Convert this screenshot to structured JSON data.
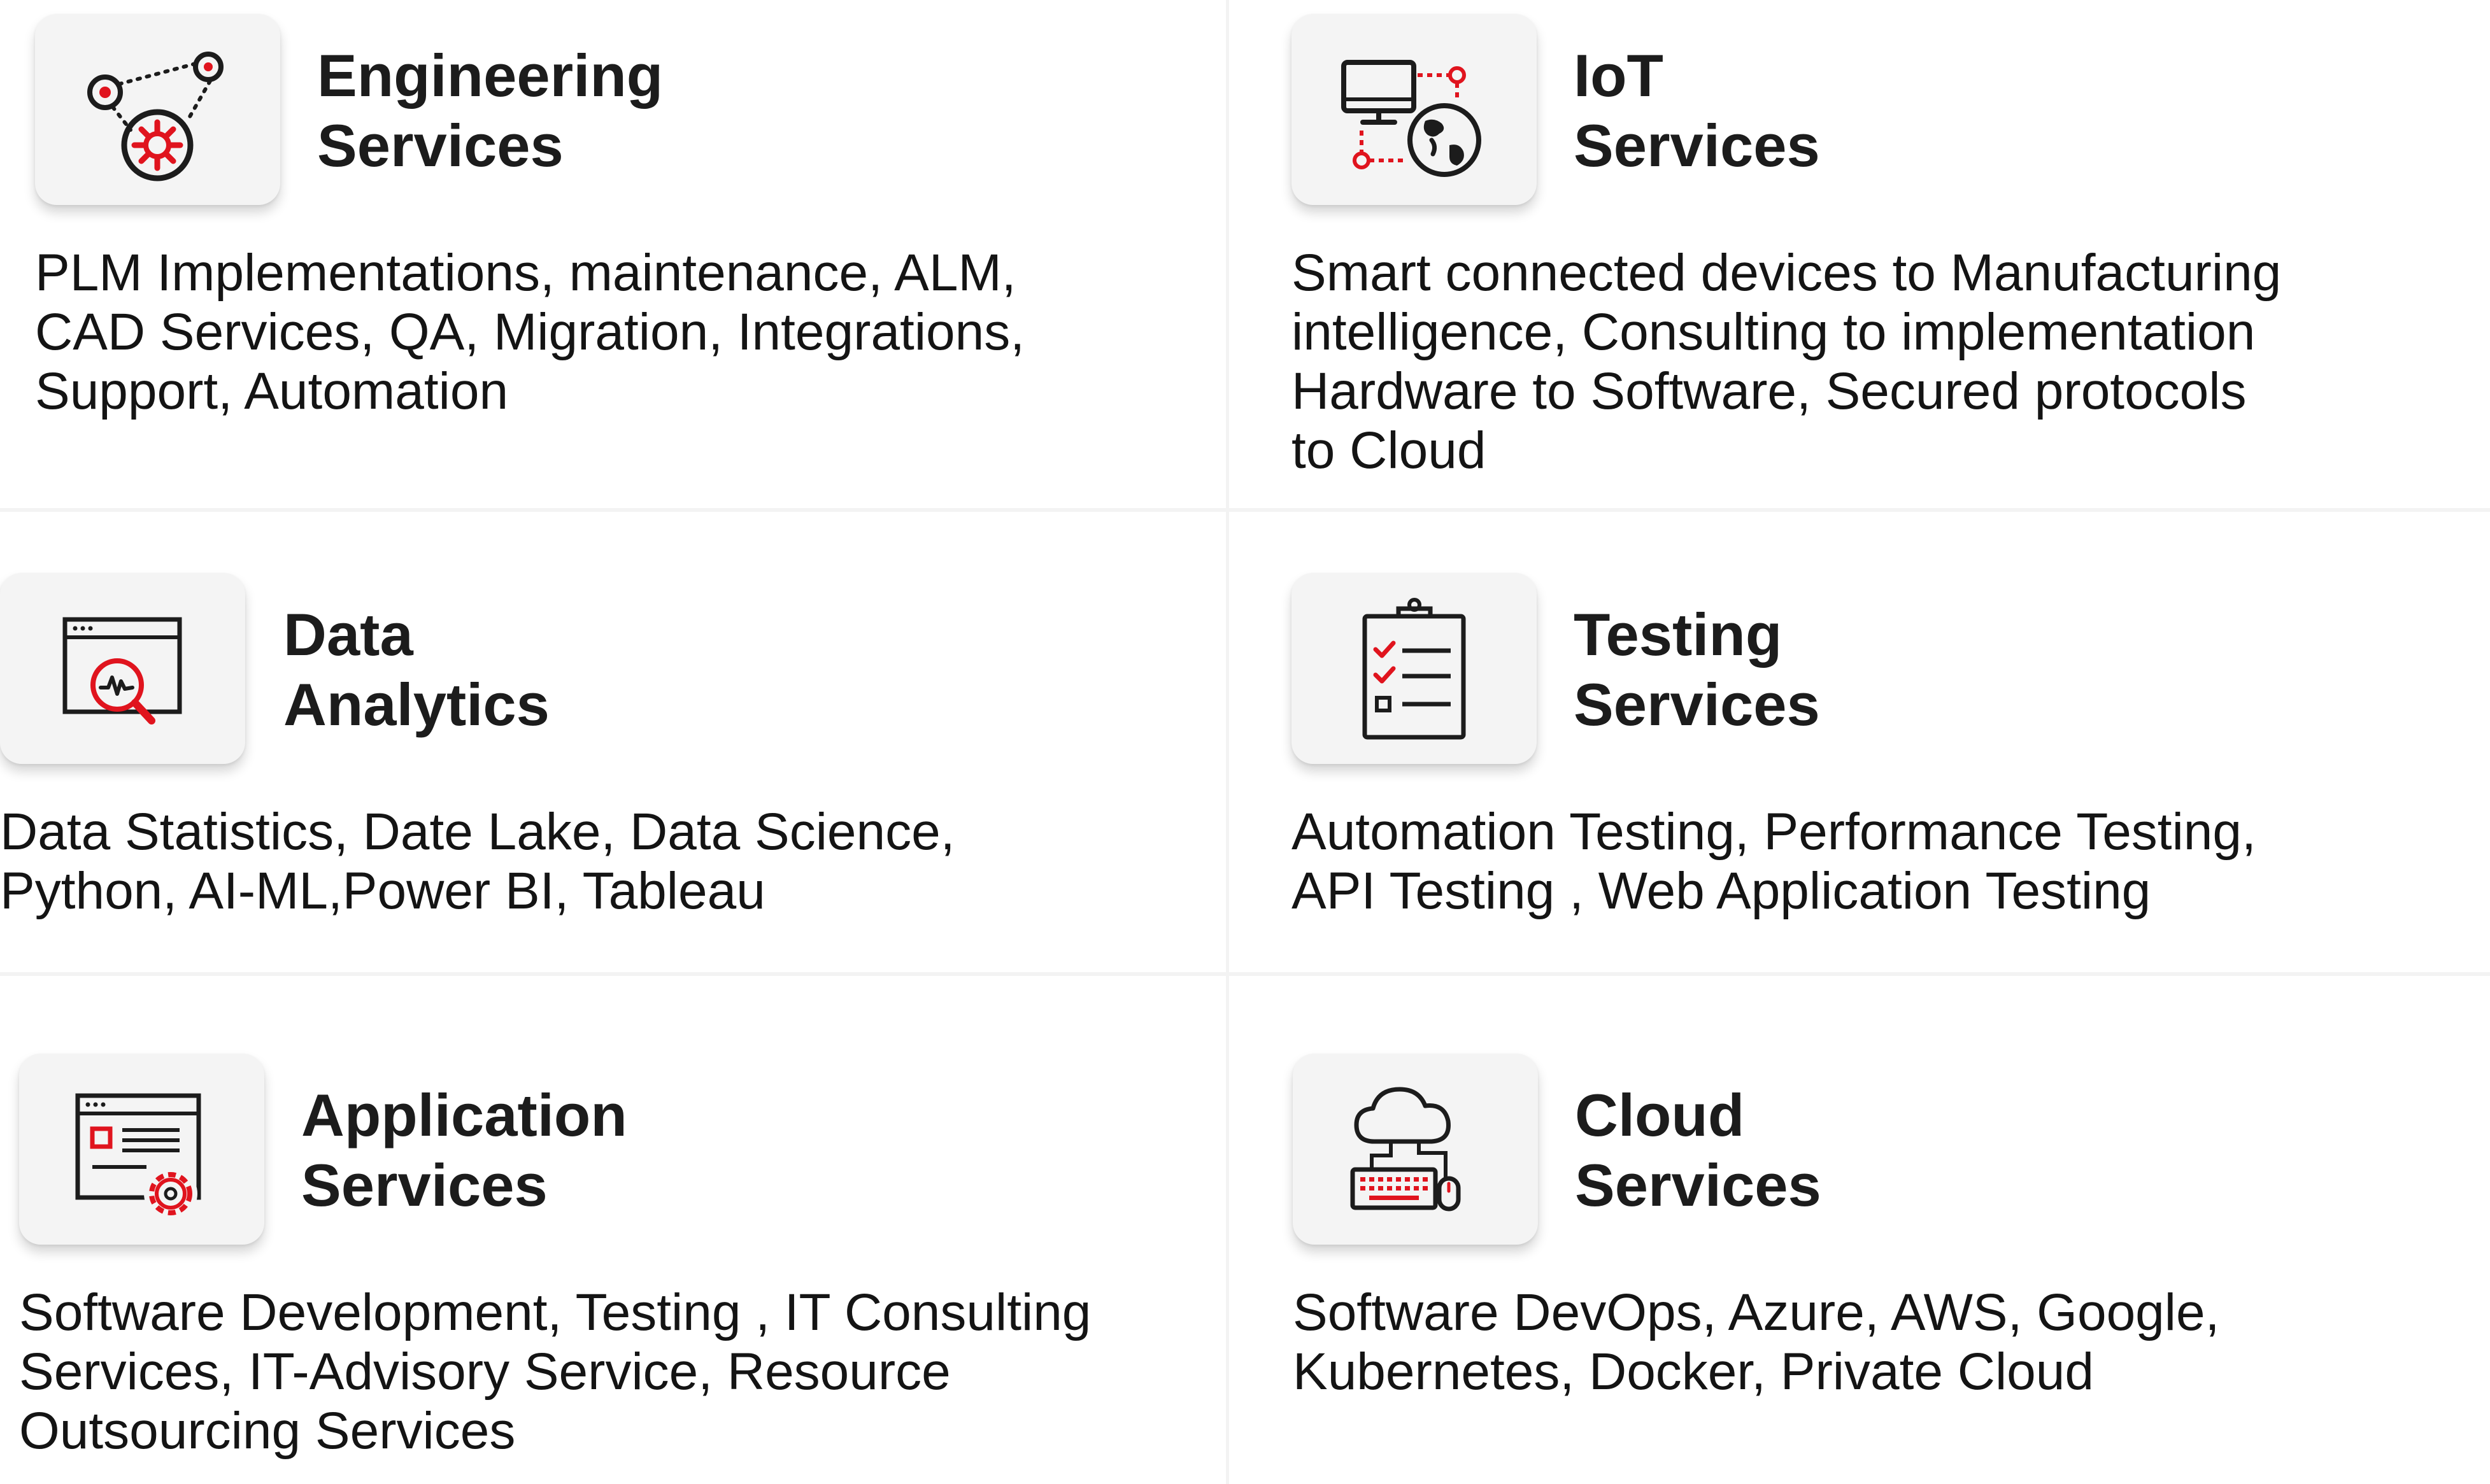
{
  "colors": {
    "accent": "#e0141e",
    "ink": "#1c1c1c",
    "tile": "#f4f4f4"
  },
  "services": [
    {
      "id": "engineering",
      "icon": "gear-network-icon",
      "title_lines": [
        "Engineering",
        "Services"
      ],
      "desc_lines": [
        "PLM Implementations, maintenance, ALM,",
        "CAD Services, QA, Migration, Integrations,",
        "Support, Automation"
      ]
    },
    {
      "id": "iot",
      "icon": "monitor-globe-icon",
      "title_lines": [
        "IoT",
        "Services"
      ],
      "desc_lines": [
        "Smart connected devices to Manufacturing",
        "intelligence, Consulting to implementation",
        "Hardware to Software, Secured protocols",
        "to Cloud"
      ]
    },
    {
      "id": "data",
      "icon": "analytics-magnifier-icon",
      "title_lines": [
        "Data",
        "Analytics"
      ],
      "desc_lines": [
        "Data Statistics, Date Lake, Data Science,",
        "Python, AI-ML,Power BI, Tableau"
      ]
    },
    {
      "id": "testing",
      "icon": "clipboard-checklist-icon",
      "title_lines": [
        "Testing",
        "Services"
      ],
      "desc_lines": [
        "Automation Testing, Performance Testing,",
        "API Testing , Web Application Testing"
      ]
    },
    {
      "id": "application",
      "icon": "app-window-gear-icon",
      "title_lines": [
        "Application",
        "Services"
      ],
      "desc_lines": [
        "Software Development, Testing , IT Consulting",
        "Services, IT-Advisory Service, Resource",
        "Outsourcing Services"
      ]
    },
    {
      "id": "cloud",
      "icon": "cloud-keyboard-icon",
      "title_lines": [
        "Cloud",
        "Services"
      ],
      "desc_lines": [
        "Software DevOps, Azure, AWS, Google,",
        "Kubernetes, Docker, Private Cloud"
      ]
    }
  ]
}
